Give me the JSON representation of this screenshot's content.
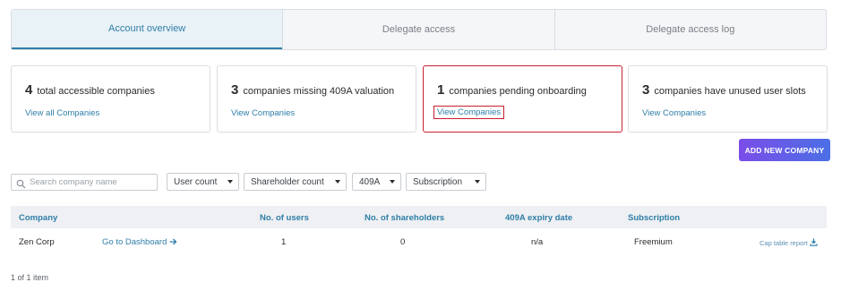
{
  "tabs": [
    {
      "label": "Account overview",
      "active": true
    },
    {
      "label": "Delegate access",
      "active": false
    },
    {
      "label": "Delegate access log",
      "active": false
    }
  ],
  "cards": [
    {
      "count": "4",
      "text": "total accessible companies",
      "link": "View all Companies"
    },
    {
      "count": "3",
      "text": "companies missing 409A valuation",
      "link": "View Companies"
    },
    {
      "count": "1",
      "text": "companies pending onboarding",
      "link": "View Companies"
    },
    {
      "count": "3",
      "text": "companies have unused user slots",
      "link": "View Companies"
    }
  ],
  "add_button_label": "ADD NEW COMPANY",
  "search": {
    "placeholder": "Search company name",
    "value": ""
  },
  "filters": [
    {
      "label": "User count"
    },
    {
      "label": "Shareholder count"
    },
    {
      "label": "409A"
    },
    {
      "label": "Subscription"
    }
  ],
  "table": {
    "columns": [
      "Company",
      "No. of users",
      "No. of shareholders",
      "409A expiry date",
      "Subscription"
    ],
    "rows": [
      {
        "company": "Zen Corp",
        "dashboard_link": "Go to Dashboard",
        "users": "1",
        "shareholders": "0",
        "expiry": "n/a",
        "subscription": "Freemium",
        "cap_table_link": "Cap table report"
      }
    ]
  },
  "pagination": "1 of 1 item",
  "colors": {
    "accent": "#2f7ea8",
    "highlight": "#c8202e",
    "button_gradient_start": "#7a4de8",
    "button_gradient_end": "#4b6fe6"
  }
}
